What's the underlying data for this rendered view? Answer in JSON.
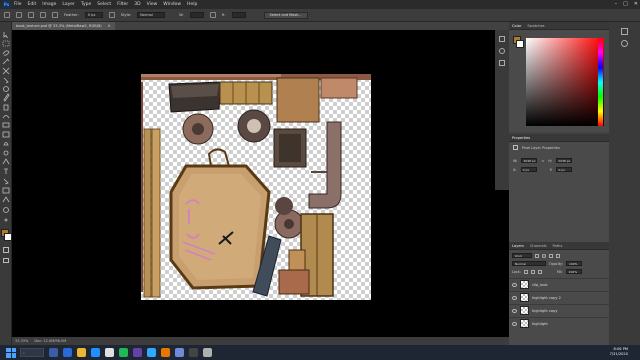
{
  "app": {
    "menu": [
      "File",
      "Edit",
      "Image",
      "Layer",
      "Type",
      "Select",
      "Filter",
      "3D",
      "View",
      "Window",
      "Help"
    ],
    "logo": "Ps"
  },
  "options": {
    "feather_label": "Feather:",
    "feather_value": "0 px",
    "style_label": "Style:",
    "style_value": "Normal",
    "select_mask_label": "Select and Mask..."
  },
  "document": {
    "tab_title": "book_texture.psd @ 33.3% (MetalRaw2, RGB/8)",
    "status_zoom": "33.33%",
    "status_doc": "Doc: 12.0M/96.0M"
  },
  "panels": {
    "color_tabs": [
      "Color",
      "Swatches"
    ],
    "properties_tab": "Properties",
    "properties_title": "Pixel Layer Properties",
    "props": {
      "w_label": "W:",
      "w_value": "2048 px",
      "h_label": "H:",
      "h_value": "2048 px",
      "x_label": "X:",
      "x_value": "0 px",
      "y_label": "Y:",
      "y_value": "0 px"
    },
    "layers_tabs": [
      "Layers",
      "Channels",
      "Paths"
    ],
    "layers_kind": "Kind",
    "blend_mode": "Normal",
    "opacity_label": "Opacity:",
    "opacity_value": "100%",
    "lock_label": "Lock:",
    "fill_label": "Fill:",
    "fill_value": "100%",
    "layers": [
      {
        "name": "clip_look"
      },
      {
        "name": "highlight copy 2"
      },
      {
        "name": "highlight copy"
      },
      {
        "name": "highlight"
      }
    ]
  },
  "taskbar": {
    "search_placeholder": "",
    "time": "8:06 PM",
    "date": "7/31/2020"
  },
  "colors": {
    "foreground": "#b07a2a",
    "background": "#ffffff",
    "canvas_bg": "#000000"
  }
}
